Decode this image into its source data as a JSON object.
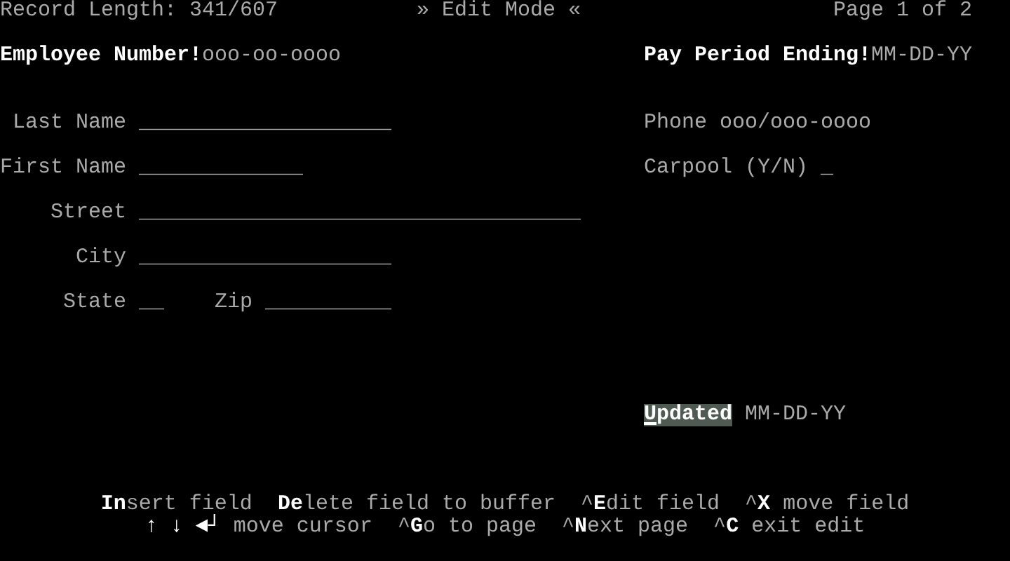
{
  "header": {
    "record_length": "Record Length: 341/607",
    "mode": "» Edit Mode «",
    "page": "Page 1 of 2"
  },
  "key_fields": [
    {
      "label": "Employee Number!",
      "mask": "ooo-oo-oooo"
    },
    {
      "label": "Pay Period Ending!",
      "mask": "MM-DD-YY"
    }
  ],
  "address_rows": [
    {
      "fields": [
        {
          "label": "Last Name",
          "blank": "____________________"
        }
      ]
    },
    {
      "fields": [
        {
          "label": "First Name",
          "blank": "_____________"
        }
      ]
    },
    {
      "fields": [
        {
          "label": "Street",
          "blank": "___________________________________"
        }
      ]
    },
    {
      "fields": [
        {
          "label": "City",
          "blank": "____________________"
        }
      ]
    },
    {
      "fields": [
        {
          "label": "State",
          "blank": "__"
        },
        {
          "label": "Zip",
          "blank": "__________"
        }
      ]
    }
  ],
  "contact_fields": [
    {
      "label": "Phone",
      "value": "ooo/ooo-oooo"
    },
    {
      "label": "Carpool (Y/N)",
      "value": "_"
    }
  ],
  "updated": {
    "label": "Updated",
    "selected": true,
    "cursor": true,
    "value": "MM-DD-YY"
  },
  "help_lines": [
    [
      "**In**sert field",
      "**De**lete field to buffer",
      "^**E**dit field",
      "^**X** move field"
    ],
    [
      "**↑ ↓ ◄┘** move cursor",
      "^**G**o to page",
      "^**N**ext page",
      "^**C** exit edit"
    ]
  ]
}
